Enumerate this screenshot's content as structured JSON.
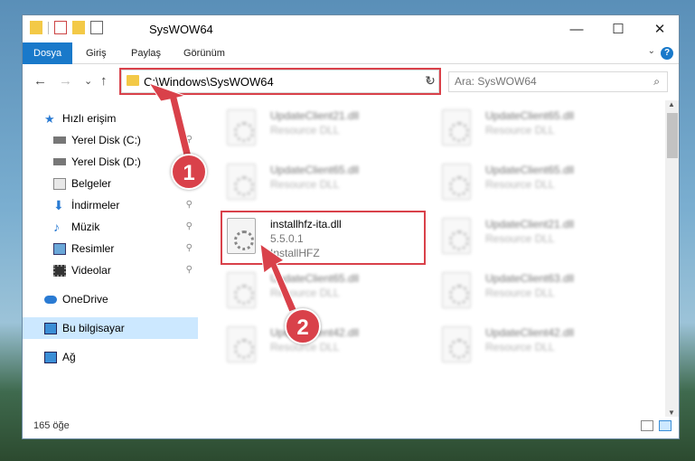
{
  "window": {
    "title": "SysWOW64",
    "minimize": "—",
    "maximize": "☐",
    "close": "✕"
  },
  "ribbon": {
    "tabs": [
      "Dosya",
      "Giriş",
      "Paylaş",
      "Görünüm"
    ],
    "help": "?",
    "collapse": "⌄"
  },
  "nav_buttons": {
    "back": "←",
    "forward": "→",
    "recent": "⌄",
    "up": "↑"
  },
  "address": {
    "path": "C:\\Windows\\SysWOW64",
    "dropdown": "⌄",
    "refresh": "↻"
  },
  "search": {
    "placeholder": "Ara: SysWOW64",
    "icon": "⌕"
  },
  "sidebar": {
    "items": [
      {
        "label": "Hızlı erişim",
        "icon": "star-icon",
        "pinned": false
      },
      {
        "label": "Yerel Disk (C:)",
        "icon": "drive-icon",
        "pinned": true
      },
      {
        "label": "Yerel Disk (D:)",
        "icon": "drive-icon",
        "pinned": true
      },
      {
        "label": "Belgeler",
        "icon": "documents-icon",
        "pinned": true
      },
      {
        "label": "İndirmeler",
        "icon": "download-icon",
        "pinned": true
      },
      {
        "label": "Müzik",
        "icon": "music-icon",
        "pinned": true
      },
      {
        "label": "Resimler",
        "icon": "pictures-icon",
        "pinned": true
      },
      {
        "label": "Videolar",
        "icon": "videos-icon",
        "pinned": true
      },
      {
        "label": "OneDrive",
        "icon": "cloud-icon",
        "pinned": false
      },
      {
        "label": "Bu bilgisayar",
        "icon": "computer-icon",
        "pinned": false
      },
      {
        "label": "Ağ",
        "icon": "network-icon",
        "pinned": false
      }
    ],
    "pin_glyph": "📌"
  },
  "files": [
    {
      "name": "UpdateClient21.dll",
      "line2": "Resource DLL",
      "line3": ""
    },
    {
      "name": "UpdateClient65.dll",
      "line2": "Resource DLL",
      "line3": ""
    },
    {
      "name": "UpdateClient65.dll",
      "line2": "Resource DLL",
      "line3": ""
    },
    {
      "name": "UpdateClient65.dll",
      "line2": "Resource DLL",
      "line3": ""
    },
    {
      "name": "installhfz-ita.dll",
      "line2": "5.5.0.1",
      "line3": "InstallHFZ"
    },
    {
      "name": "UpdateClient21.dll",
      "line2": "Resource DLL",
      "line3": ""
    },
    {
      "name": "UpdateClient65.dll",
      "line2": "Resource DLL",
      "line3": ""
    },
    {
      "name": "UpdateClient63.dll",
      "line2": "Resource DLL",
      "line3": ""
    },
    {
      "name": "UpdateClient42.dll",
      "line2": "Resource DLL",
      "line3": ""
    },
    {
      "name": "UpdateClient42.dll",
      "line2": "Resource DLL",
      "line3": ""
    }
  ],
  "status": {
    "count": "165 öğe"
  },
  "annotations": {
    "step1": "1",
    "step2": "2"
  },
  "colors": {
    "accent": "#1979ca",
    "highlight": "#d9414a",
    "selection": "#cce8ff"
  }
}
